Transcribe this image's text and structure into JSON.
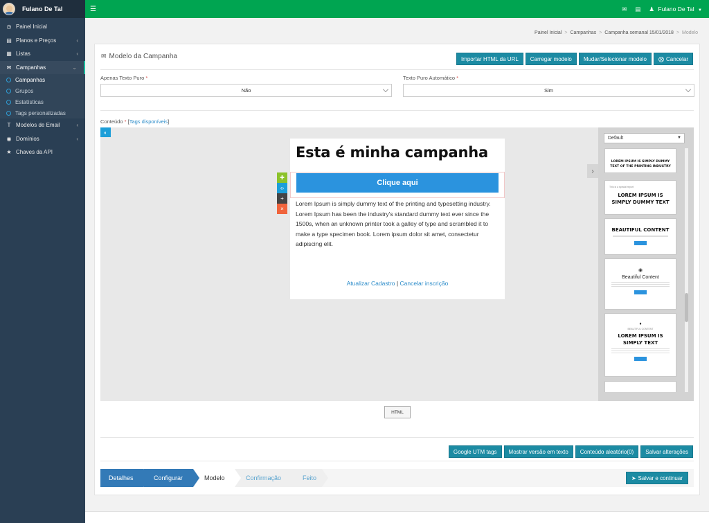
{
  "sidebar": {
    "username": "Fulano De Tal",
    "items": [
      {
        "label": "Painel Inicial",
        "icon": "dashboard-icon"
      },
      {
        "label": "Planos e Preços",
        "icon": "file-icon"
      },
      {
        "label": "Listas",
        "icon": "table-icon"
      },
      {
        "label": "Campanhas",
        "icon": "envelope-icon"
      },
      {
        "label": "Modelos de Email",
        "icon": "text-icon"
      },
      {
        "label": "Domínios",
        "icon": "globe-icon"
      },
      {
        "label": "Chaves da API",
        "icon": "star-icon"
      }
    ],
    "subitems": [
      "Campanhas",
      "Grupos",
      "Estatísticas",
      "Tags personalizadas"
    ]
  },
  "topbar": {
    "user": "Fulano De Tal"
  },
  "breadcrumb": [
    "Painel Inicial",
    "Campanhas",
    "Campanha semanal 15/01/2018",
    "Modelo"
  ],
  "panel": {
    "title": "Modelo da Campanha",
    "buttons": [
      "Importar HTML da URL",
      "Carregar modelo",
      "Mudar/Selecionar modelo",
      "Cancelar"
    ],
    "plain_text_label": "Apenas Texto Puro",
    "plain_text_value": "Não",
    "auto_plain_label": "Texto Puro Automático",
    "auto_plain_value": "Sim",
    "required_mark": "*",
    "content_label": "Conteúdo",
    "tags_link": "Tags disponíveis"
  },
  "email": {
    "title": "Esta é minha campanha",
    "button": "Clique aqui",
    "body": "Lorem Ipsum is simply dummy text of the printing and typesetting industry. Lorem Ipsum has been the industry's standard dummy text ever since the 1500s, when an unknown printer took a galley of type and scrambled it to make a type specimen book. Lorem ipsum dolor sit amet, consectetur adipiscing elit.",
    "footer_update": "Atualizar Cadastro",
    "footer_sep": "|",
    "footer_unsub": "Cancelar inscrição"
  },
  "blocks": {
    "select_value": "Default",
    "b1_title": "LOREM IPSUM IS SIMPLY DUMMY TEXT OF THE PRINTING INDUSTRY",
    "b2_kicker": "This is a special report",
    "b2_title": "LOREM IPSUM IS SIMPLY DUMMY TEXT",
    "b3_title": "BEAUTIFUL CONTENT",
    "b4_title": "Beautiful Content",
    "b5_kicker": "BEAUTIFUL CONTENT",
    "b5_title": "LOREM IPSUM IS SIMPLY TEXT"
  },
  "editor": {
    "html_button": "HTML"
  },
  "bottom_buttons": [
    "Google UTM tags",
    "Mostrar versão em texto",
    "Conteúdo aleatório(0)",
    "Salvar alterações"
  ],
  "wizard": {
    "steps": [
      "Detalhes",
      "Configurar",
      "Modelo",
      "Confirmação",
      "Feito"
    ],
    "save_continue": "Salvar e continuar"
  }
}
